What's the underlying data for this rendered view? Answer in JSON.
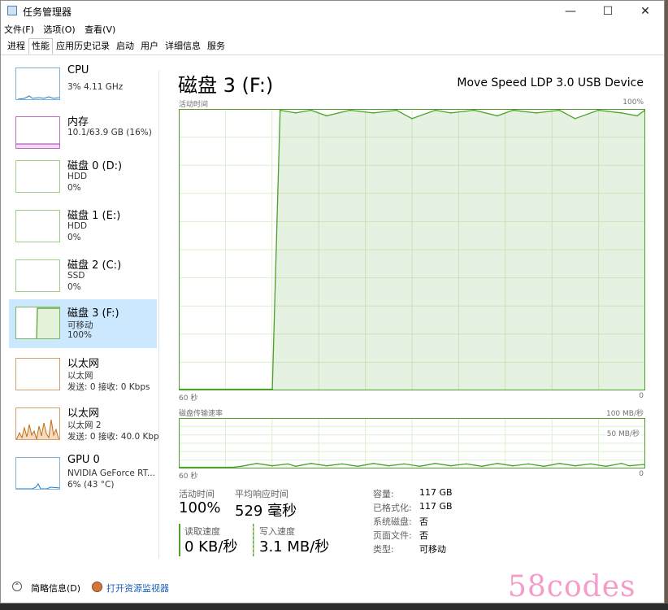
{
  "window": {
    "title": "任务管理器"
  },
  "menubar": {
    "items": [
      "文件(F)",
      "选项(O)",
      "查看(V)"
    ]
  },
  "tabs": [
    "进程",
    "性能",
    "应用历史记录",
    "启动",
    "用户",
    "详细信息",
    "服务"
  ],
  "sidebar": {
    "items": [
      {
        "name": "CPU",
        "sub1": "3% 4.11 GHz",
        "sub2": ""
      },
      {
        "name": "内存",
        "sub1": "10.1/63.9 GB (16%)",
        "sub2": ""
      },
      {
        "name": "磁盘 0 (D:)",
        "sub1": "HDD",
        "sub2": "0%"
      },
      {
        "name": "磁盘 1 (E:)",
        "sub1": "HDD",
        "sub2": "0%"
      },
      {
        "name": "磁盘 2 (C:)",
        "sub1": "SSD",
        "sub2": "0%"
      },
      {
        "name": "磁盘 3 (F:)",
        "sub1": "可移动",
        "sub2": "100%"
      },
      {
        "name": "以太网",
        "sub1": "以太网",
        "sub2": "发送: 0 接收: 0 Kbps"
      },
      {
        "name": "以太网",
        "sub1": "以太网 2",
        "sub2": "发送: 0 接收: 40.0 Kbp"
      },
      {
        "name": "GPU 0",
        "sub1": "NVIDIA GeForce RT...",
        "sub2": "6% (43 °C)"
      }
    ]
  },
  "main": {
    "title": "磁盘 3 (F:)",
    "device": "Move Speed LDP 3.0 USB Device",
    "chart1": {
      "label": "活动时间",
      "max": "100%",
      "left": "60 秒",
      "right": "0"
    },
    "chart2": {
      "label": "磁盘传输速率",
      "max": "100 MB/秒",
      "mid": "50 MB/秒",
      "left": "60 秒",
      "right": "0"
    }
  },
  "stats": {
    "active_label": "活动时间",
    "active_value": "100%",
    "resp_label": "平均响应时间",
    "resp_value": "529 毫秒",
    "read_label": "读取速度",
    "read_value": "0 KB/秒",
    "write_label": "写入速度",
    "write_value": "3.1 MB/秒"
  },
  "details": [
    {
      "label": "容量:",
      "value": "117 GB"
    },
    {
      "label": "已格式化:",
      "value": "117 GB"
    },
    {
      "label": "系统磁盘:",
      "value": "否"
    },
    {
      "label": "页面文件:",
      "value": "否"
    },
    {
      "label": "类型:",
      "value": "可移动"
    }
  ],
  "footer": {
    "brief": "简略信息(D)",
    "monitor": "打开资源监视器"
  },
  "watermark": "58codes",
  "chart_data": [
    {
      "type": "area",
      "title": "活动时间",
      "ylim": [
        0,
        100
      ],
      "x": [
        60,
        48,
        47,
        45,
        43,
        41,
        38,
        35,
        32,
        30,
        27,
        25,
        22,
        19,
        17,
        14,
        11,
        9,
        6,
        3,
        1,
        0
      ],
      "values": [
        0,
        0,
        100,
        99,
        100,
        98,
        100,
        99,
        100,
        97,
        100,
        99,
        100,
        98,
        100,
        99,
        100,
        97,
        100,
        99,
        98,
        100
      ]
    },
    {
      "type": "line",
      "title": "磁盘传输速率",
      "ylim": [
        0,
        100
      ],
      "x": [
        60,
        53,
        52,
        50,
        48,
        46,
        45,
        43,
        41,
        39,
        37,
        35,
        33,
        31,
        29,
        27,
        25,
        23,
        21,
        19,
        17,
        15,
        13,
        11,
        9,
        7,
        5,
        3,
        2,
        0
      ],
      "values": [
        0,
        0,
        2,
        8,
        3,
        7,
        2,
        8,
        3,
        7,
        2,
        8,
        3,
        7,
        2,
        8,
        3,
        7,
        2,
        8,
        3,
        7,
        2,
        8,
        3,
        7,
        2,
        8,
        3,
        6
      ]
    }
  ]
}
